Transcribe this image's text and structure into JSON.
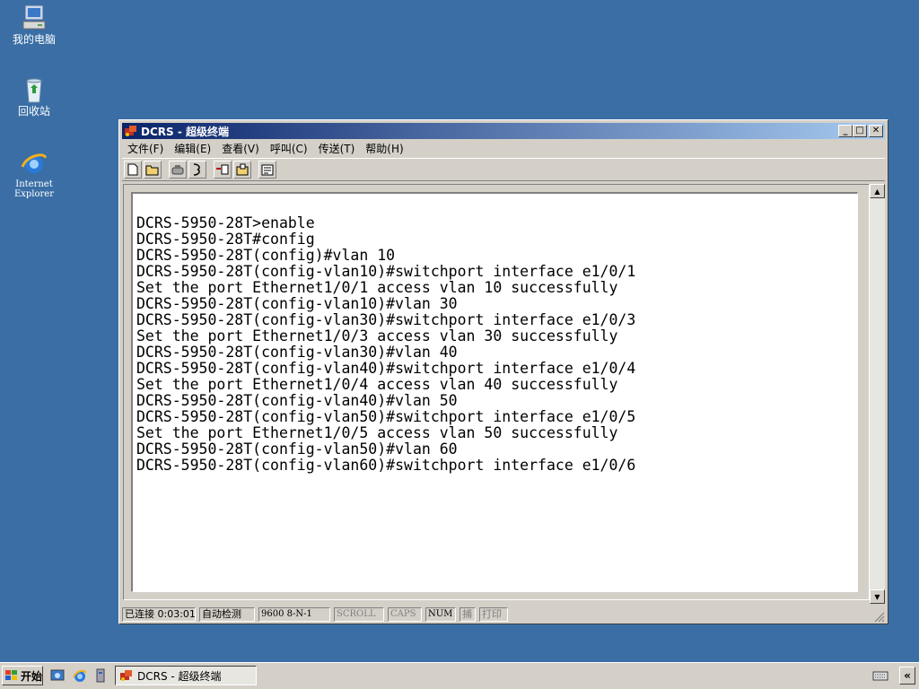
{
  "desktop": {
    "icons": [
      {
        "label": "我的电脑",
        "icon": "my-computer-icon"
      },
      {
        "label": "回收站",
        "icon": "recycle-bin-icon"
      },
      {
        "label_line1": "Internet",
        "label_line2": "Explorer",
        "icon": "internet-explorer-icon"
      }
    ],
    "background_color": "#3a6ea5"
  },
  "window": {
    "title": "DCRS - 超级终端",
    "controls": [
      "minimize",
      "maximize",
      "close"
    ]
  },
  "menu": [
    "文件(F)",
    "编辑(E)",
    "查看(V)",
    "呼叫(C)",
    "传送(T)",
    "帮助(H)"
  ],
  "toolbar": [
    "new-icon",
    "open-icon",
    "disconnect-icon",
    "call-icon",
    "send-icon",
    "receive-icon",
    "properties-icon"
  ],
  "terminal": {
    "lines": [
      "DCRS-5950-28T>enable",
      "DCRS-5950-28T#config",
      "DCRS-5950-28T(config)#vlan 10",
      "DCRS-5950-28T(config-vlan10)#switchport interface e1/0/1",
      "Set the port Ethernet1/0/1 access vlan 10 successfully",
      "DCRS-5950-28T(config-vlan10)#vlan 30",
      "DCRS-5950-28T(config-vlan30)#switchport interface e1/0/3",
      "Set the port Ethernet1/0/3 access vlan 30 successfully",
      "DCRS-5950-28T(config-vlan30)#vlan 40",
      "DCRS-5950-28T(config-vlan40)#switchport interface e1/0/4",
      "Set the port Ethernet1/0/4 access vlan 40 successfully",
      "DCRS-5950-28T(config-vlan40)#vlan 50",
      "DCRS-5950-28T(config-vlan50)#switchport interface e1/0/5",
      "Set the port Ethernet1/0/5 access vlan 50 successfully",
      "DCRS-5950-28T(config-vlan50)#vlan 60",
      "DCRS-5950-28T(config-vlan60)#switchport interface e1/0/6"
    ]
  },
  "status": {
    "connected": "已连接 0:03:01",
    "detect": "自动检测",
    "params": "9600 8-N-1",
    "scroll": "SCROLL",
    "caps": "CAPS",
    "num": "NUM",
    "capture": "捕",
    "print": "打印"
  },
  "taskbar": {
    "start": "开始",
    "task_label": "DCRS - 超级终端"
  }
}
